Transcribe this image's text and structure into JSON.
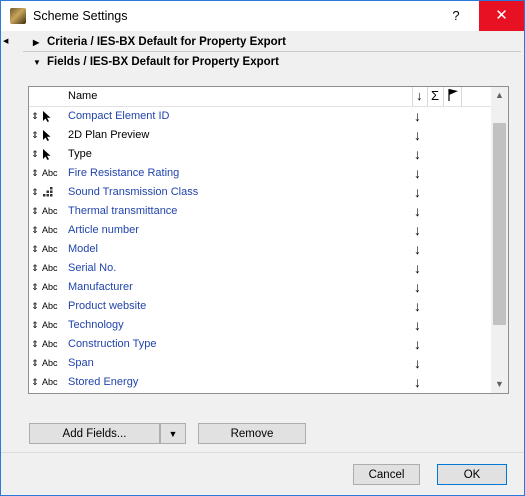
{
  "window": {
    "title": "Scheme Settings",
    "help_label": "?",
    "close_label": "✕"
  },
  "sections": [
    {
      "label": "Criteria / IES-BX Default for Property Export",
      "expanded": false
    },
    {
      "label": "Fields / IES-BX Default for Property Export",
      "expanded": true
    }
  ],
  "list": {
    "header": {
      "name": "Name",
      "sort_icon": "↓",
      "sum_icon": "Σ",
      "flag_icon": "flag-icon"
    },
    "rows": [
      {
        "icon": "cursor-icon",
        "label": "Compact Element ID",
        "linked": true
      },
      {
        "icon": "cursor-icon",
        "label": "2D Plan Preview",
        "linked": false
      },
      {
        "icon": "cursor-icon",
        "label": "Type",
        "linked": false
      },
      {
        "icon": "text-icon",
        "label": "Fire Resistance Rating",
        "linked": true
      },
      {
        "icon": "option-set-icon",
        "label": "Sound Transmission Class",
        "linked": true
      },
      {
        "icon": "text-icon",
        "label": "Thermal transmittance",
        "linked": true
      },
      {
        "icon": "text-icon",
        "label": "Article number",
        "linked": true
      },
      {
        "icon": "text-icon",
        "label": "Model",
        "linked": true
      },
      {
        "icon": "text-icon",
        "label": "Serial No.",
        "linked": true
      },
      {
        "icon": "text-icon",
        "label": "Manufacturer",
        "linked": true
      },
      {
        "icon": "text-icon",
        "label": "Product website",
        "linked": true
      },
      {
        "icon": "text-icon",
        "label": "Technology",
        "linked": true
      },
      {
        "icon": "text-icon",
        "label": "Construction Type",
        "linked": true
      },
      {
        "icon": "text-icon",
        "label": "Span",
        "linked": true
      },
      {
        "icon": "text-icon",
        "label": "Stored Energy",
        "linked": true
      }
    ],
    "text_icon_label": "Abc",
    "sort_arrow": "↓"
  },
  "buttons": {
    "add_fields": "Add Fields...",
    "remove": "Remove",
    "cancel": "Cancel",
    "ok": "OK"
  },
  "colors": {
    "link_text": "#2244aa",
    "close_button": "#e81123",
    "window_border": "#2b79d8"
  }
}
